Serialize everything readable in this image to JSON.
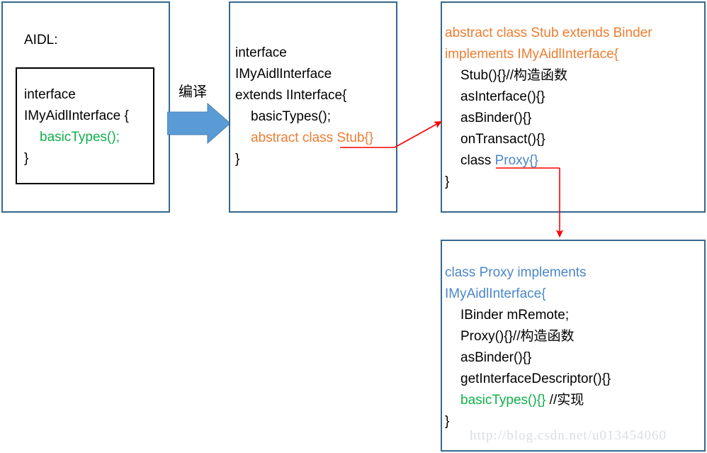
{
  "diagram": {
    "title_label": "AIDL:",
    "compile_label": "编译",
    "watermark": "http://blog.csdn.net/u013454060",
    "colors": {
      "panel_border": "#35688F",
      "inner_border": "#000000",
      "orange": "#ED7D31",
      "blue": "#4A87C8",
      "green": "#0FB04B",
      "black": "#000000",
      "arrow_blue": "#5B9BD5",
      "connector_red": "#FF0000",
      "watermark_gray": "#D9DEE4"
    },
    "panels": {
      "aidl": {
        "name": "AIDL source file",
        "lines": [
          {
            "indent": 0,
            "parts": [
              {
                "text": "interface",
                "color": "black"
              }
            ]
          },
          {
            "indent": 0,
            "parts": [
              {
                "text": "IMyAidlInterface {",
                "color": "black"
              }
            ]
          },
          {
            "indent": 1,
            "parts": [
              {
                "text": "basicTypes();",
                "color": "green"
              }
            ]
          },
          {
            "indent": 0,
            "parts": [
              {
                "text": "}",
                "color": "black"
              }
            ]
          }
        ]
      },
      "interface": {
        "name": "generated interface",
        "lines": [
          {
            "indent": 0,
            "parts": [
              {
                "text": "interface",
                "color": "black"
              }
            ]
          },
          {
            "indent": 0,
            "parts": [
              {
                "text": "IMyAidlInterface",
                "color": "black"
              }
            ]
          },
          {
            "indent": 0,
            "parts": [
              {
                "text": "extends IInterface{",
                "color": "black"
              }
            ]
          },
          {
            "indent": 1,
            "parts": [
              {
                "text": "basicTypes();",
                "color": "black"
              }
            ]
          },
          {
            "indent": 1,
            "parts": [
              {
                "text": "abstract class Stub{}",
                "color": "orange"
              }
            ]
          },
          {
            "indent": 0,
            "parts": [
              {
                "text": "}",
                "color": "black"
              }
            ]
          }
        ]
      },
      "stub": {
        "name": "Stub class",
        "lines": [
          {
            "indent": 0,
            "parts": [
              {
                "text": "abstract class Stub extends Binder",
                "color": "orange"
              }
            ]
          },
          {
            "indent": 0,
            "parts": [
              {
                "text": "implements IMyAidlInterface{",
                "color": "orange"
              }
            ]
          },
          {
            "indent": 1,
            "parts": [
              {
                "text": "Stub(){}//构造函数",
                "color": "black"
              }
            ]
          },
          {
            "indent": 1,
            "parts": [
              {
                "text": "asInterface(){}",
                "color": "black"
              }
            ]
          },
          {
            "indent": 1,
            "parts": [
              {
                "text": "asBinder(){}",
                "color": "black"
              }
            ]
          },
          {
            "indent": 1,
            "parts": [
              {
                "text": "onTransact(){}",
                "color": "black"
              }
            ]
          },
          {
            "indent": 1,
            "parts": [
              {
                "text": "class ",
                "color": "black"
              },
              {
                "text": "Proxy{}",
                "color": "blue"
              }
            ]
          },
          {
            "indent": 0,
            "parts": [
              {
                "text": "}",
                "color": "black"
              }
            ]
          }
        ]
      },
      "proxy": {
        "name": "Proxy class",
        "lines": [
          {
            "indent": 0,
            "parts": [
              {
                "text": "class Proxy implements",
                "color": "blue"
              }
            ]
          },
          {
            "indent": 0,
            "parts": [
              {
                "text": "IMyAidlInterface{",
                "color": "blue"
              }
            ]
          },
          {
            "indent": 1,
            "parts": [
              {
                "text": "IBinder mRemote;",
                "color": "black"
              }
            ]
          },
          {
            "indent": 1,
            "parts": [
              {
                "text": "Proxy(){}//构造函数",
                "color": "black"
              }
            ]
          },
          {
            "indent": 1,
            "parts": [
              {
                "text": "asBinder(){}",
                "color": "black"
              }
            ]
          },
          {
            "indent": 1,
            "parts": [
              {
                "text": "getInterfaceDescriptor(){}",
                "color": "black"
              }
            ]
          },
          {
            "indent": 1,
            "parts": [
              {
                "text": "basicTypes(){}",
                "color": "green"
              },
              {
                "text": " //实现",
                "color": "black"
              }
            ]
          },
          {
            "indent": 0,
            "parts": [
              {
                "text": "}",
                "color": "black"
              }
            ]
          }
        ]
      }
    },
    "connectors": [
      {
        "name": "compile-arrow",
        "from": "aidl",
        "to": "interface",
        "style": "blue-block-arrow",
        "label": "编译"
      },
      {
        "name": "stub-expand-arrow",
        "from": "interface",
        "to": "stub",
        "style": "red-elbow-arrow"
      },
      {
        "name": "proxy-expand-arrow",
        "from": "stub",
        "to": "proxy",
        "style": "red-elbow-arrow"
      }
    ]
  }
}
